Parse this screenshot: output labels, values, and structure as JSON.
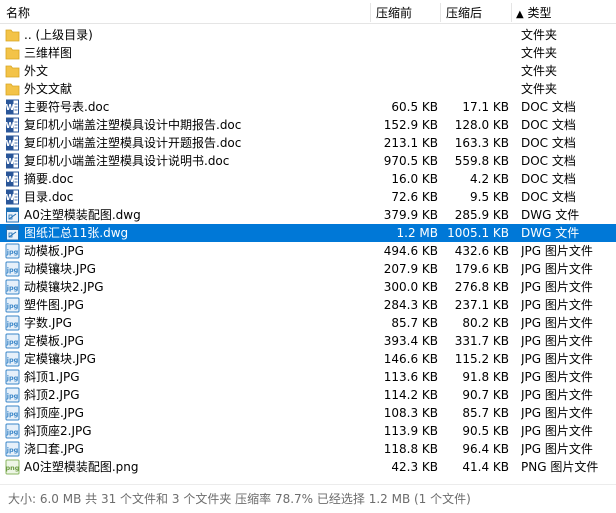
{
  "columns": {
    "name": "名称",
    "original_size": "压缩前",
    "compressed_size": "压缩后",
    "type": "类型",
    "sort_indicator": "▲"
  },
  "files": [
    {
      "name": ".. (上级目录)",
      "orig": "",
      "comp": "",
      "type": "文件夹",
      "icon": "folder-up-icon",
      "selected": false
    },
    {
      "name": "三维样图",
      "orig": "",
      "comp": "",
      "type": "文件夹",
      "icon": "folder-icon",
      "selected": false
    },
    {
      "name": "外文",
      "orig": "",
      "comp": "",
      "type": "文件夹",
      "icon": "folder-icon",
      "selected": false
    },
    {
      "name": "外文文献",
      "orig": "",
      "comp": "",
      "type": "文件夹",
      "icon": "folder-icon",
      "selected": false
    },
    {
      "name": "主要符号表.doc",
      "orig": "60.5 KB",
      "comp": "17.1 KB",
      "type": "DOC 文档",
      "icon": "word-doc-icon",
      "selected": false
    },
    {
      "name": "复印机小端盖注塑模具设计中期报告.doc",
      "orig": "152.9 KB",
      "comp": "128.0 KB",
      "type": "DOC 文档",
      "icon": "word-doc-icon",
      "selected": false
    },
    {
      "name": "复印机小端盖注塑模具设计开题报告.doc",
      "orig": "213.1 KB",
      "comp": "163.3 KB",
      "type": "DOC 文档",
      "icon": "word-doc-icon",
      "selected": false
    },
    {
      "name": "复印机小端盖注塑模具设计说明书.doc",
      "orig": "970.5 KB",
      "comp": "559.8 KB",
      "type": "DOC 文档",
      "icon": "word-doc-icon",
      "selected": false
    },
    {
      "name": "摘要.doc",
      "orig": "16.0 KB",
      "comp": "4.2 KB",
      "type": "DOC 文档",
      "icon": "word-doc-icon",
      "selected": false
    },
    {
      "name": "目录.doc",
      "orig": "72.6 KB",
      "comp": "9.5 KB",
      "type": "DOC 文档",
      "icon": "word-doc-icon",
      "selected": false
    },
    {
      "name": "A0注塑模装配图.dwg",
      "orig": "379.9 KB",
      "comp": "285.9 KB",
      "type": "DWG 文件",
      "icon": "dwg-file-icon",
      "selected": false
    },
    {
      "name": "图纸汇总11张.dwg",
      "orig": "1.2 MB",
      "comp": "1005.1 KB",
      "type": "DWG 文件",
      "icon": "dwg-file-icon",
      "selected": true
    },
    {
      "name": "动模板.JPG",
      "orig": "494.6 KB",
      "comp": "432.6 KB",
      "type": "JPG 图片文件",
      "icon": "jpg-image-icon",
      "selected": false
    },
    {
      "name": "动模镶块.JPG",
      "orig": "207.9 KB",
      "comp": "179.6 KB",
      "type": "JPG 图片文件",
      "icon": "jpg-image-icon",
      "selected": false
    },
    {
      "name": "动模镶块2.JPG",
      "orig": "300.0 KB",
      "comp": "276.8 KB",
      "type": "JPG 图片文件",
      "icon": "jpg-image-icon",
      "selected": false
    },
    {
      "name": "塑件图.JPG",
      "orig": "284.3 KB",
      "comp": "237.1 KB",
      "type": "JPG 图片文件",
      "icon": "jpg-image-icon",
      "selected": false
    },
    {
      "name": "字数.JPG",
      "orig": "85.7 KB",
      "comp": "80.2 KB",
      "type": "JPG 图片文件",
      "icon": "jpg-image-icon",
      "selected": false
    },
    {
      "name": "定模板.JPG",
      "orig": "393.4 KB",
      "comp": "331.7 KB",
      "type": "JPG 图片文件",
      "icon": "jpg-image-icon",
      "selected": false
    },
    {
      "name": "定模镶块.JPG",
      "orig": "146.6 KB",
      "comp": "115.2 KB",
      "type": "JPG 图片文件",
      "icon": "jpg-image-icon",
      "selected": false
    },
    {
      "name": "斜顶1.JPG",
      "orig": "113.6 KB",
      "comp": "91.8 KB",
      "type": "JPG 图片文件",
      "icon": "jpg-image-icon",
      "selected": false
    },
    {
      "name": "斜顶2.JPG",
      "orig": "114.2 KB",
      "comp": "90.7 KB",
      "type": "JPG 图片文件",
      "icon": "jpg-image-icon",
      "selected": false
    },
    {
      "name": "斜顶座.JPG",
      "orig": "108.3 KB",
      "comp": "85.7 KB",
      "type": "JPG 图片文件",
      "icon": "jpg-image-icon",
      "selected": false
    },
    {
      "name": "斜顶座2.JPG",
      "orig": "113.9 KB",
      "comp": "90.5 KB",
      "type": "JPG 图片文件",
      "icon": "jpg-image-icon",
      "selected": false
    },
    {
      "name": "浇口套.JPG",
      "orig": "118.8 KB",
      "comp": "96.4 KB",
      "type": "JPG 图片文件",
      "icon": "jpg-image-icon",
      "selected": false
    },
    {
      "name": "A0注塑模装配图.png",
      "orig": "42.3 KB",
      "comp": "41.4 KB",
      "type": "PNG 图片文件",
      "icon": "png-image-icon",
      "selected": false
    }
  ],
  "status": {
    "text": "大小: 6.0 MB 共 31 个文件和 3 个文件夹 压缩率 78.7% 已经选择 1.2 MB (1 个文件)"
  },
  "colors": {
    "selection": "#0078d7",
    "folder": "#f3c348",
    "doc_blue": "#2a5699",
    "dwg_blue": "#1f6fb5",
    "jpg_blue": "#3a86c8",
    "png_green": "#8ab560"
  }
}
